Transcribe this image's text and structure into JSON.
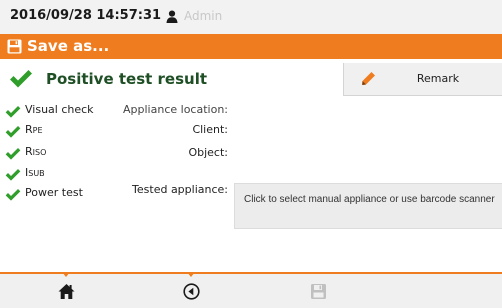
{
  "status_bar": {
    "datetime": "2016/09/28 14:57:31",
    "user_icon": "user-icon",
    "user": "Admin"
  },
  "title_bar": {
    "icon": "floppy-disk-icon",
    "title": "Save as..."
  },
  "result": {
    "icon": "check-icon",
    "text": "Positive test result"
  },
  "remark_button": {
    "icon": "pencil-icon",
    "label": "Remark"
  },
  "tests": [
    {
      "main": "Visual check",
      "sub": ""
    },
    {
      "main": "R",
      "sub": "PE"
    },
    {
      "main": "R",
      "sub": "ISO"
    },
    {
      "main": "I",
      "sub": "SUB"
    },
    {
      "main": "Power test",
      "sub": ""
    }
  ],
  "fields": {
    "appliance_location": "Appliance location:",
    "client": "Client:",
    "object": "Object:",
    "tested_appliance": "Tested appliance:",
    "tested_appliance_hint": "Click to select manual appliance or use barcode scanner"
  },
  "bottom_bar": {
    "buttons": [
      "home-icon",
      "back-icon",
      "save-icon"
    ],
    "save_enabled": false
  },
  "colors": {
    "accent": "#ef7c1e",
    "check": "#2f9e2a",
    "result_text": "#1f4f25",
    "disabled": "#c0c0c0"
  }
}
